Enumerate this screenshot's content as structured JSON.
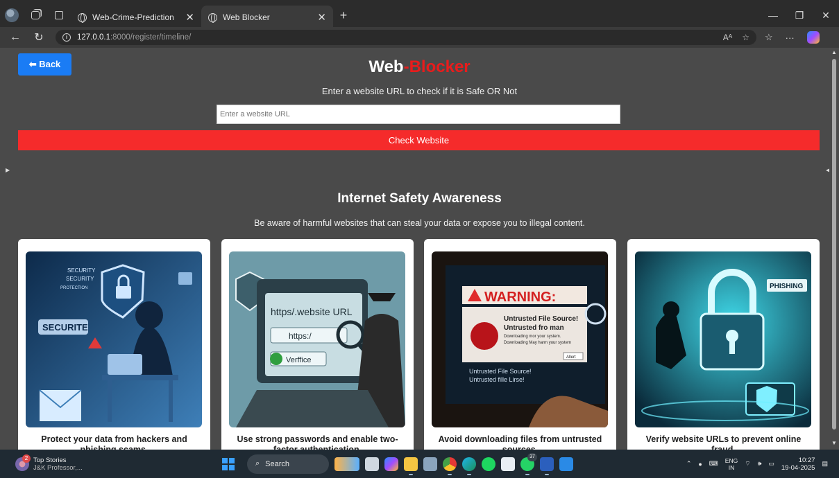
{
  "browser": {
    "tabs": [
      {
        "label": "Web-Crime-Prediction",
        "active": false
      },
      {
        "label": "Web Blocker",
        "active": true
      }
    ],
    "url_host": "127.0.0.1",
    "url_path": ":8000/register/timeline/",
    "reader_label": "Aᴬ"
  },
  "page": {
    "back_label": "⬅ Back",
    "title_main": "Web",
    "title_accent": "-Blocker",
    "subtitle": "Enter a website URL to check if it is Safe OR Not",
    "url_placeholder": "Enter a website URL",
    "check_label": "Check Website",
    "awareness_title": "Internet Safety Awareness",
    "awareness_sub": "Be aware of harmful websites that can steal your data or expose you to illegal content.",
    "cards": [
      {
        "caption": "Protect your data from hackers and phishing scams.",
        "img_text": [
          "SECURITY",
          "SECURITY",
          "PROTECTION",
          "SECURITE"
        ]
      },
      {
        "caption": "Use strong passwords and enable two-factor authentication.",
        "img_text": [
          "https/.website URL",
          "https:/",
          "Verffice"
        ]
      },
      {
        "caption": "Avoid downloading files from untrusted sources.",
        "img_text": [
          "WARNING:",
          "Untrusted File Source!",
          "Untrusted fro man",
          "Downloading mor your system.",
          "Downloading May harm your system",
          "Untrusted File Source!",
          "Untrusted fille Lirse!",
          "Allert"
        ]
      },
      {
        "caption": "Verify website URLs to prevent online fraud.",
        "img_text": [
          "PHISHING"
        ]
      }
    ]
  },
  "taskbar": {
    "news_badge": "2",
    "news_title": "Top Stories",
    "news_sub": "J&K Professor,...",
    "search_label": "Search",
    "whatsapp_badge": "37",
    "lang_top": "ENG",
    "lang_bottom": "IN",
    "time": "10:27",
    "date": "19-04-2025"
  },
  "colors": {
    "accent_red": "#e81c1c",
    "back_blue": "#1a7cf5",
    "check_red": "#f52b2b",
    "page_bg": "#4a4a4a"
  }
}
